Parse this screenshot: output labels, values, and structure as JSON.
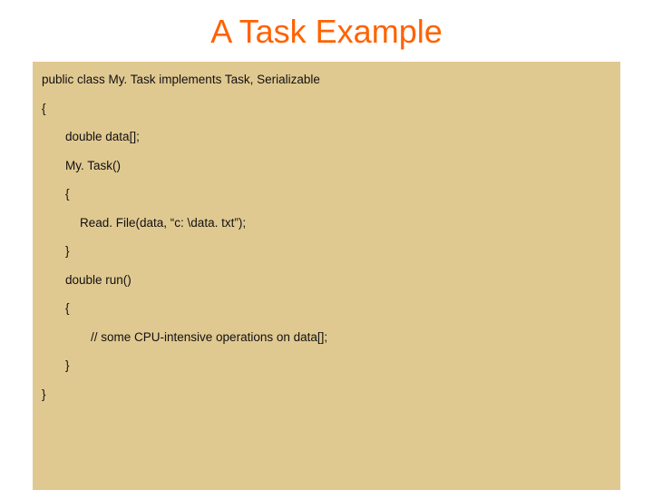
{
  "title": "A Task Example",
  "code": {
    "l0": "public class My. Task implements Task, Serializable",
    "l1": "{",
    "l2": "double data[];",
    "l3": "My. Task()",
    "l4": "{",
    "l5": "Read. File(data, “c: \\data. txt”);",
    "l6": "}",
    "l7": "double run()",
    "l8": "{",
    "l9": " // some CPU-intensive operations on data[];",
    "l10": "}",
    "l11": "}"
  }
}
